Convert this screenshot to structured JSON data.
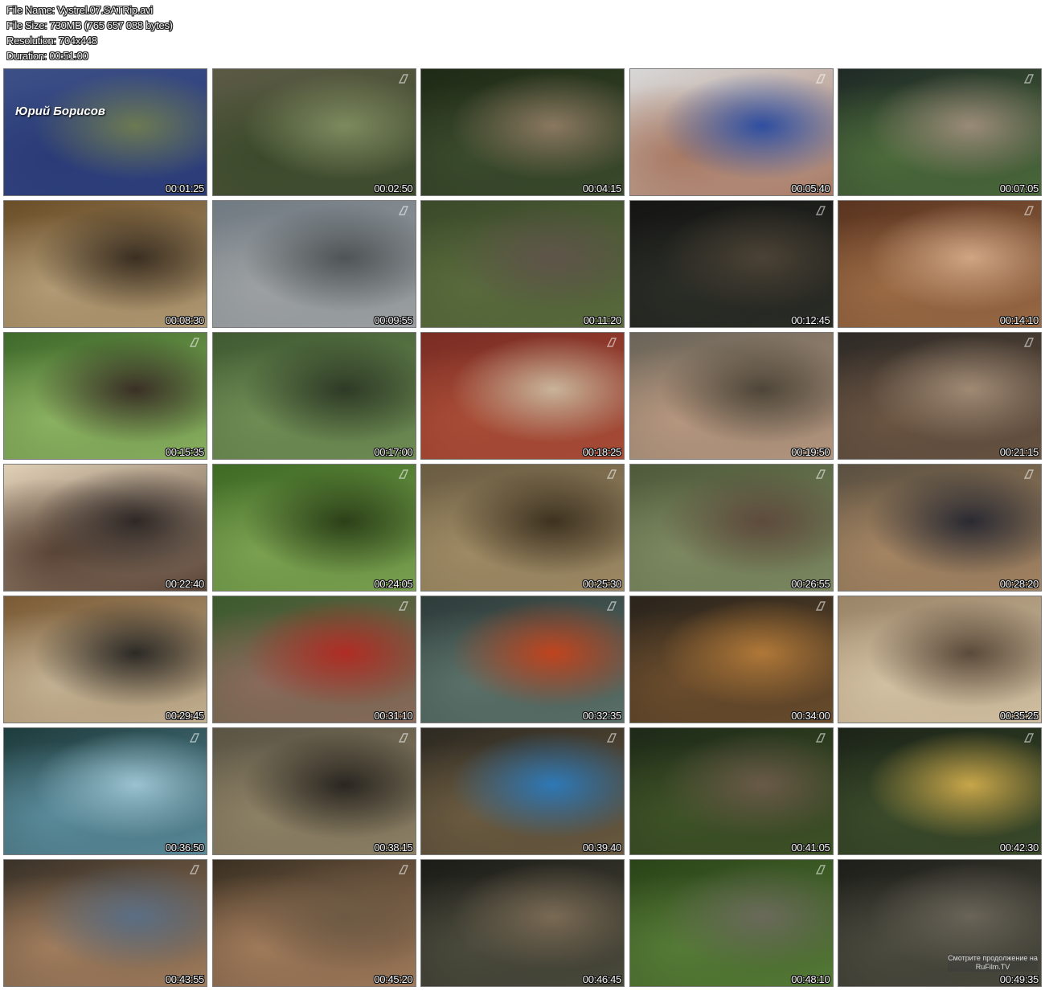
{
  "info": {
    "file_name": "File Name: Vystrel.07.SATRip.avi",
    "file_size": "File Size: 730MB (765 657 088 bytes)",
    "resolution": "Resolution: 704x448",
    "duration": "Duration: 00:51:00"
  },
  "overlay_caption": "Юрий Борисов",
  "watermark": "Смотрите продолжение на RuFilm.TV",
  "thumbnails": [
    {
      "time": "00:01:25",
      "colors": [
        "#3c4f86",
        "#2a3b78",
        "#6c7a52"
      ],
      "logo": false
    },
    {
      "time": "00:02:50",
      "colors": [
        "#5b5a44",
        "#3c4a2c",
        "#7d8a5e"
      ],
      "logo": true
    },
    {
      "time": "00:04:15",
      "colors": [
        "#1f2a16",
        "#3a4a2c",
        "#8a7860"
      ],
      "logo": false
    },
    {
      "time": "00:05:40",
      "colors": [
        "#d8d8d8",
        "#a87a64",
        "#2e4ea0"
      ],
      "logo": true
    },
    {
      "time": "00:07:05",
      "colors": [
        "#1f2a26",
        "#4b6a3a",
        "#9a8b78"
      ],
      "logo": true
    },
    {
      "time": "00:08:30",
      "colors": [
        "#6a4e28",
        "#b19a74",
        "#3b2f22"
      ],
      "logo": false
    },
    {
      "time": "00:09:55",
      "colors": [
        "#707a82",
        "#9ca0a2",
        "#4f5456"
      ],
      "logo": true
    },
    {
      "time": "00:11:20",
      "colors": [
        "#3b4a2a",
        "#596b3c",
        "#5f544a"
      ],
      "logo": false
    },
    {
      "time": "00:12:45",
      "colors": [
        "#151614",
        "#2a2c26",
        "#4b4235"
      ],
      "logo": true
    },
    {
      "time": "00:14:10",
      "colors": [
        "#5a3420",
        "#9a6a44",
        "#cfa584"
      ],
      "logo": true
    },
    {
      "time": "00:15:35",
      "colors": [
        "#3f6a2a",
        "#8ab060",
        "#3a3026"
      ],
      "logo": true
    },
    {
      "time": "00:17:00",
      "colors": [
        "#405a32",
        "#6f8c54",
        "#2e3a26"
      ],
      "logo": false
    },
    {
      "time": "00:18:25",
      "colors": [
        "#7a2c24",
        "#a84c36",
        "#c8b49a"
      ],
      "logo": true
    },
    {
      "time": "00:19:50",
      "colors": [
        "#6a6458",
        "#b5967e",
        "#4e4639"
      ],
      "logo": false
    },
    {
      "time": "00:21:15",
      "colors": [
        "#2e2a26",
        "#6a5442",
        "#a08a74"
      ],
      "logo": true
    },
    {
      "time": "00:22:40",
      "colors": [
        "#e0d0b6",
        "#5a4436",
        "#2e2826"
      ],
      "logo": false
    },
    {
      "time": "00:24:05",
      "colors": [
        "#3e6a24",
        "#7aa050",
        "#2c4018"
      ],
      "logo": true
    },
    {
      "time": "00:25:30",
      "colors": [
        "#6a5c42",
        "#9e8a64",
        "#3e3220"
      ],
      "logo": true
    },
    {
      "time": "00:26:55",
      "colors": [
        "#4e5a3a",
        "#7c8860",
        "#5e4a3c"
      ],
      "logo": true
    },
    {
      "time": "00:28:20",
      "colors": [
        "#5a5040",
        "#a48462",
        "#2a2a32"
      ],
      "logo": true
    },
    {
      "time": "00:29:45",
      "colors": [
        "#7a5a34",
        "#c2b092",
        "#2c2a26"
      ],
      "logo": false
    },
    {
      "time": "00:31:10",
      "colors": [
        "#3a5a2c",
        "#8a6a5c",
        "#b02c24"
      ],
      "logo": true
    },
    {
      "time": "00:32:35",
      "colors": [
        "#2e3c3a",
        "#5a7068",
        "#c0441e"
      ],
      "logo": true
    },
    {
      "time": "00:34:00",
      "colors": [
        "#2a241c",
        "#6a4c2c",
        "#b07838"
      ],
      "logo": true
    },
    {
      "time": "00:35:25",
      "colors": [
        "#9a8468",
        "#d2c0a2",
        "#5a4a3a"
      ],
      "logo": false
    },
    {
      "time": "00:36:50",
      "colors": [
        "#1e3c3c",
        "#5a8a9a",
        "#9ac2d0"
      ],
      "logo": true
    },
    {
      "time": "00:38:15",
      "colors": [
        "#5a5444",
        "#8c8064",
        "#2a2620"
      ],
      "logo": true
    },
    {
      "time": "00:39:40",
      "colors": [
        "#2e2a22",
        "#6a5a40",
        "#2e78b6"
      ],
      "logo": true
    },
    {
      "time": "00:41:05",
      "colors": [
        "#1e2a18",
        "#3e5226",
        "#6a5a48"
      ],
      "logo": true
    },
    {
      "time": "00:42:30",
      "colors": [
        "#1c2418",
        "#3a4a2a",
        "#c8a64a"
      ],
      "logo": true
    },
    {
      "time": "00:43:55",
      "colors": [
        "#3a3228",
        "#a07c5c",
        "#5a6e84"
      ],
      "logo": true
    },
    {
      "time": "00:45:20",
      "colors": [
        "#3a3022",
        "#a07a5a",
        "#6e5a44"
      ],
      "logo": true
    },
    {
      "time": "00:46:45",
      "colors": [
        "#1c1c18",
        "#4a4a3c",
        "#7a6a54"
      ],
      "logo": false
    },
    {
      "time": "00:48:10",
      "colors": [
        "#2a4418",
        "#557a36",
        "#6a6a5a"
      ],
      "logo": true
    },
    {
      "time": "00:49:35",
      "colors": [
        "#1e1e1a",
        "#4a4a3e",
        "#6a6458"
      ],
      "logo": false
    }
  ]
}
